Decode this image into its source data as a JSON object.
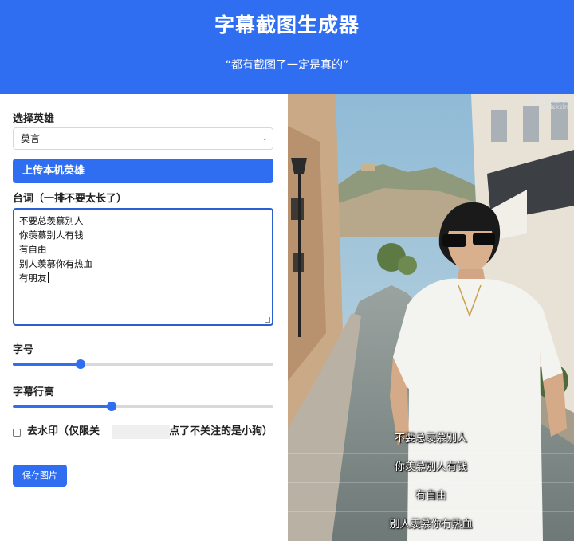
{
  "header": {
    "title": "字幕截图生成器",
    "subtitle": "“都有截图了一定是真的”"
  },
  "form": {
    "hero_label": "选择英雄",
    "hero_selected": "莫言",
    "upload_button": "上传本机英雄",
    "lines_label": "台词（一排不要太长了）",
    "lines": [
      "不要总羡慕别人",
      "你羡慕别人有钱",
      "有自由",
      "别人羡慕你有热血",
      "有朋友"
    ],
    "font_size_label": "字号",
    "font_size_level": 0.26,
    "line_height_label": "字幕行高",
    "line_height_level": 0.38,
    "watermark_checkbox_checked": false,
    "watermark_label_part1": "去水印（仅限关",
    "watermark_label_part2": "使用，点了不关注的是小狗）",
    "save_button": "保存图片"
  },
  "preview": {
    "watermark_line1": "字幕截图生成器",
    "watermark_line2": "@disksing",
    "subtitles": [
      "不要总羡慕别人",
      "你羡慕别人有钱",
      "有自由",
      "别人羡慕你有热血"
    ]
  },
  "colors": {
    "primary": "#2f6ef0",
    "focus_border": "#2a5fcf",
    "sky": "#9cc4dc",
    "street": "#7f8a89",
    "shirt": "#f3f3f0"
  }
}
